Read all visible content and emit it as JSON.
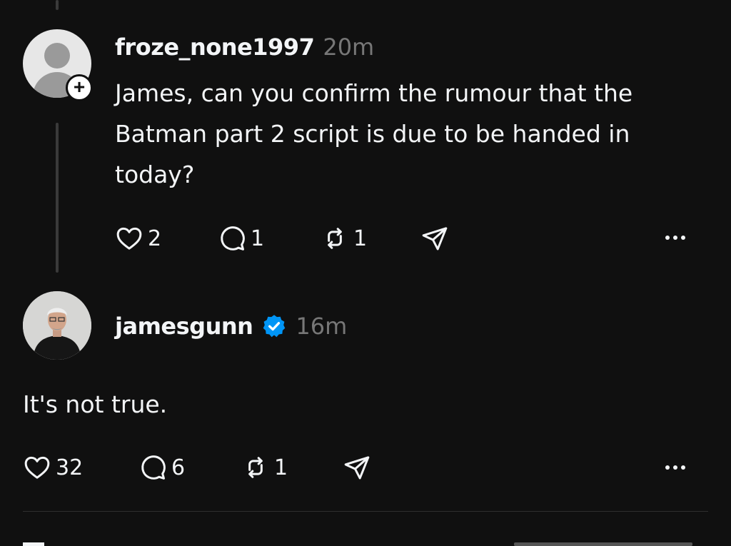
{
  "post": {
    "username": "froze_none1997",
    "time": "20m",
    "text": "James, can you confirm the rumour that the Batman part 2 script is due to be handed in today?",
    "likes": "2",
    "replies": "1",
    "reposts": "1",
    "follow_badge": "+"
  },
  "reply": {
    "username": "jamesgunn",
    "time": "16m",
    "verified": true,
    "text": "It's not true.",
    "likes": "32",
    "replies": "6",
    "reposts": "1"
  },
  "icons": {
    "like": "heart-icon",
    "reply": "comment-icon",
    "repost": "repost-icon",
    "share": "send-icon",
    "more": "more-icon",
    "verified": "verified-badge-icon"
  },
  "colors": {
    "background": "#101010",
    "text": "#f3f5f7",
    "secondary": "#777777",
    "verified": "#0095f6"
  }
}
